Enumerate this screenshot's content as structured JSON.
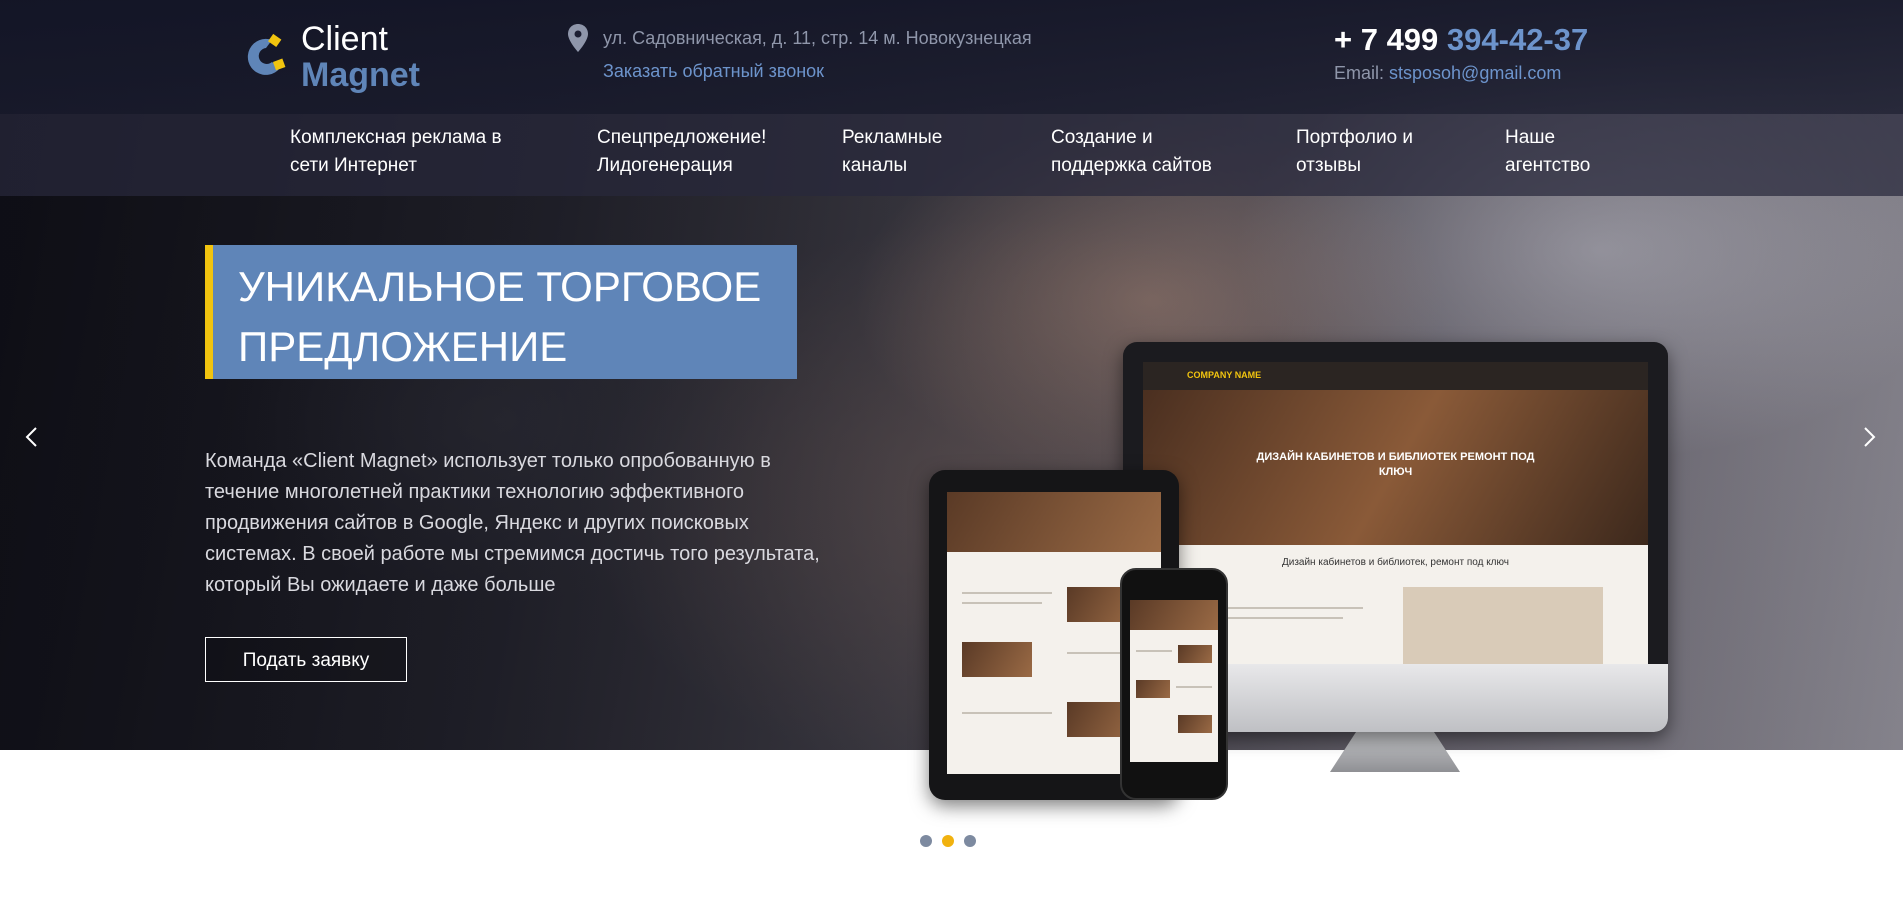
{
  "header": {
    "logo_line1": "Client",
    "logo_line2": "Magnet",
    "address": "ул. Садовническая, д. 11, стр. 14 м. Новокузнецкая",
    "callback_link": "Заказать обратный звонок",
    "phone_prefix": "+ 7 499 ",
    "phone_number": "394-42-37",
    "email_label": "Email: ",
    "email": "stsposoh@gmail.com"
  },
  "nav": [
    {
      "label": "Комплексная реклама в\nсети Интернет"
    },
    {
      "label": "Спецпредложение!\nЛидогенерация"
    },
    {
      "label": "Рекламные\nканалы"
    },
    {
      "label": "Создание и\nподдержка сайтов"
    },
    {
      "label": "Портфолио и\nотзывы"
    },
    {
      "label": "Наше\nагентство"
    }
  ],
  "hero": {
    "title": "УНИКАЛЬНОЕ ТОРГОВОЕ ПРЕДЛОЖЕНИЕ",
    "text": "Команда «Client Magnet» использует только опробованную в течение многолетней практики технологию эффективного продвижения сайтов в Google, Яндекс и других поисковых системах. В своей работе мы стремимся достичь того результата, который Вы ожидаете и даже больше",
    "cta": "Подать заявку"
  },
  "mockup": {
    "company": "COMPANY",
    "company_accent": "NAME",
    "hero_text": "ДИЗАЙН КАБИНЕТОВ И БИБЛИОТЕК РЕМОНТ ПОД КЛЮЧ",
    "subtitle": "Дизайн кабинетов и библиотек, ремонт под ключ"
  },
  "slider": {
    "dots": 3,
    "active_dot": 2
  },
  "colors": {
    "accent_blue": "#5f85b8",
    "accent_yellow": "#f1c40f",
    "link_blue": "#6d94cc"
  },
  "icons": {
    "pin": "map-pin-icon",
    "prev": "chevron-left-icon",
    "next": "chevron-right-icon",
    "logo": "magnet-logo-icon"
  }
}
